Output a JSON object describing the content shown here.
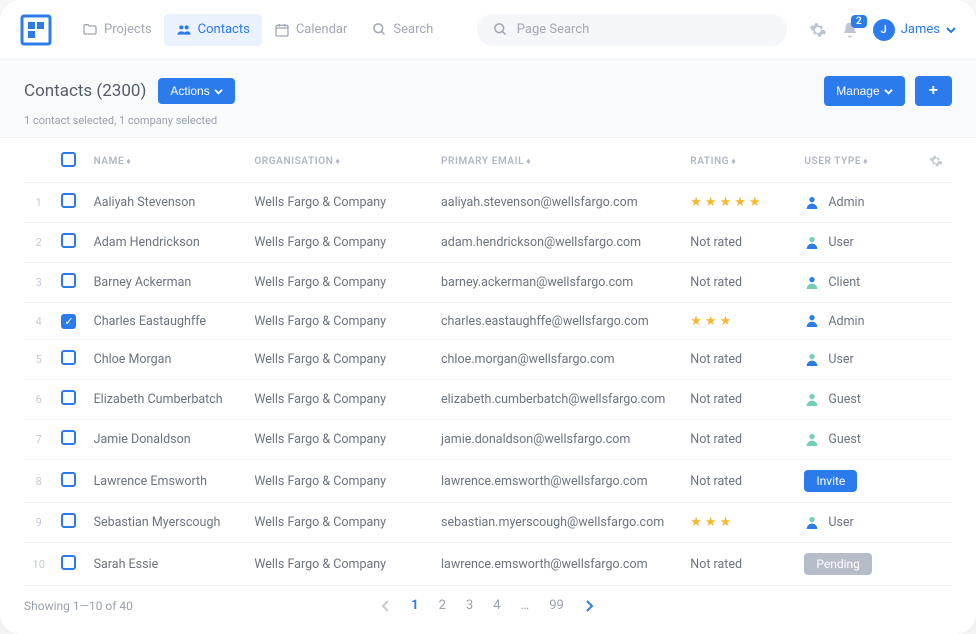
{
  "nav": {
    "items": [
      {
        "label": "Projects",
        "icon": "folder",
        "active": false
      },
      {
        "label": "Contacts",
        "icon": "people",
        "active": true
      },
      {
        "label": "Calendar",
        "icon": "calendar",
        "active": false
      },
      {
        "label": "Search",
        "icon": "search",
        "active": false
      }
    ],
    "search_placeholder": "Page Search",
    "notifications_count": "2",
    "user_name": "James"
  },
  "header": {
    "title": "Contacts (2300)",
    "actions_label": "Actions",
    "manage_label": "Manage",
    "add_label": "+",
    "selection_text": "1 contact selected, 1 company selected"
  },
  "columns": {
    "name": "NAME",
    "organisation": "ORGANISATION",
    "email": "PRIMARY EMAIL",
    "rating": "RATING",
    "usertype": "USER TYPE"
  },
  "rows": [
    {
      "n": "1",
      "checked": false,
      "name": "Aaliyah Stevenson",
      "org": "Wells Fargo & Company",
      "email": "aaliyah.stevenson@wellsfargo.com",
      "rating": 5,
      "usertype": "Admin",
      "ut_style": "admin"
    },
    {
      "n": "2",
      "checked": false,
      "name": "Adam Hendrickson",
      "org": "Wells Fargo & Company",
      "email": "adam.hendrickson@wellsfargo.com",
      "rating": 0,
      "usertype": "User",
      "ut_style": "user"
    },
    {
      "n": "3",
      "checked": false,
      "name": "Barney Ackerman",
      "org": "Wells Fargo & Company",
      "email": "barney.ackerman@wellsfargo.com",
      "rating": 0,
      "usertype": "Client",
      "ut_style": "client"
    },
    {
      "n": "4",
      "checked": true,
      "name": "Charles Eastaughffe",
      "org": "Wells Fargo & Company",
      "email": "charles.eastaughffe@wellsfargo.com",
      "rating": 3,
      "usertype": "Admin",
      "ut_style": "admin"
    },
    {
      "n": "5",
      "checked": false,
      "name": "Chloe Morgan",
      "org": "Wells Fargo & Company",
      "email": "chloe.morgan@wellsfargo.com",
      "rating": 0,
      "usertype": "User",
      "ut_style": "user"
    },
    {
      "n": "6",
      "checked": false,
      "name": "Elizabeth Cumberbatch",
      "org": "Wells Fargo & Company",
      "email": "elizabeth.cumberbatch@wellsfargo.com",
      "rating": 0,
      "usertype": "Guest",
      "ut_style": "guest"
    },
    {
      "n": "7",
      "checked": false,
      "name": "Jamie Donaldson",
      "org": "Wells Fargo & Company",
      "email": "jamie.donaldson@wellsfargo.com",
      "rating": 0,
      "usertype": "Guest",
      "ut_style": "guest"
    },
    {
      "n": "8",
      "checked": false,
      "name": "Lawrence Emsworth",
      "org": "Wells Fargo & Company",
      "email": "lawrence.emsworth@wellsfargo.com",
      "rating": 0,
      "usertype": "Invite",
      "ut_style": "invite"
    },
    {
      "n": "9",
      "checked": false,
      "name": "Sebastian Myerscough",
      "org": "Wells Fargo & Company",
      "email": "sebastian.myerscough@wellsfargo.com",
      "rating": 3,
      "usertype": "User",
      "ut_style": "user"
    },
    {
      "n": "10",
      "checked": false,
      "name": "Sarah Essie",
      "org": "Wells Fargo & Company",
      "email": "lawrence.emsworth@wellsfargo.com",
      "rating": 0,
      "usertype": "Pending",
      "ut_style": "pending"
    }
  ],
  "not_rated_label": "Not rated",
  "footer": {
    "summary": "Showing 1—10 of 40",
    "pages": [
      "1",
      "2",
      "3",
      "4",
      "…",
      "99"
    ],
    "current": "1"
  }
}
